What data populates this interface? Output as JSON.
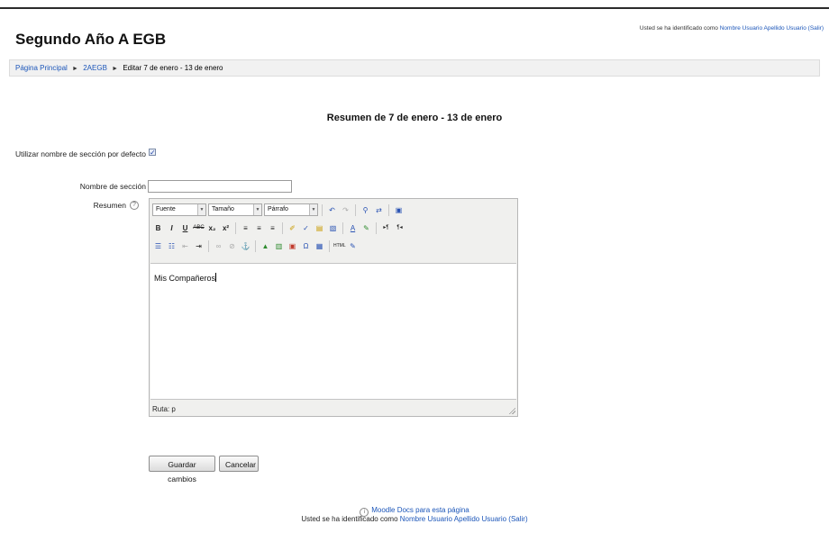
{
  "header": {
    "title": "Segundo Año A EGB",
    "login_prefix": "Usted se ha identificado como",
    "user_name": "Nombre Usuario Apellido Usuario",
    "logout": "(Salir)"
  },
  "breadcrumb": {
    "items": [
      "Página Principal",
      "2AEGB",
      "Editar 7 de enero - 13 de enero"
    ],
    "separator": "►"
  },
  "section_heading": "Resumen de 7 de enero - 13 de enero",
  "form": {
    "default_name_label": "Utilizar nombre de sección por defecto",
    "default_name_checked": true,
    "section_name_label": "Nombre de sección",
    "section_name_value": "",
    "summary_label": "Resumen",
    "help_icon_glyph": "?"
  },
  "editor": {
    "font_select": "Fuente",
    "size_select": "Tamaño",
    "format_select": "Párrafo",
    "content": "Mis Compañeros",
    "path_label": "Ruta: p",
    "toolbar_row2_glyphs": [
      "B",
      "I",
      "U",
      "ABC",
      "x₂",
      "x²"
    ],
    "row2_icons": [
      "bold-icon",
      "italic-icon",
      "underline-icon",
      "strikethrough-icon",
      "subscript-icon",
      "superscript-icon",
      "align-left-icon",
      "align-center-icon",
      "align-right-icon",
      "clean-icon",
      "spellcheck-icon",
      "paste-text-icon",
      "paste-word-icon",
      "font-color-icon",
      "highlight-icon",
      "ltr-icon",
      "rtl-icon"
    ],
    "row3_icons": [
      "bullet-list-icon",
      "number-list-icon",
      "outdent-icon",
      "indent-icon",
      "link-icon",
      "unlink-icon",
      "anchor-icon",
      "image-icon",
      "media-icon",
      "special-char-icon",
      "table-icon",
      "html-icon",
      "more-icon"
    ]
  },
  "buttons": {
    "save": "Guardar cambios",
    "cancel": "Cancelar"
  },
  "footer": {
    "docs_link": "Moodle Docs para esta página",
    "login_prefix": "Usted se ha identificado como",
    "user_name": "Nombre Usuario Apellido Usuario",
    "logout": "(Salir)"
  },
  "colors": {
    "link": "#1c56b9",
    "navbar_bg": "#f1f1f1",
    "editor_bg": "#f0f0ee"
  }
}
